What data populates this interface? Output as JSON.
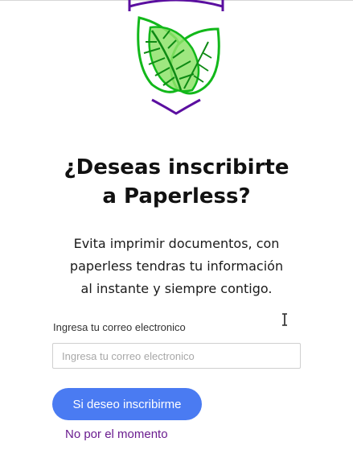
{
  "logo": {
    "icon": "leaf-shield-icon",
    "colors": {
      "shield": "#5b0fa0",
      "leaf_outline": "#12b81a",
      "leaf_fill": "#8ee36a"
    }
  },
  "heading": {
    "line1": "¿Deseas inscribirte",
    "line2": "a Paperless?"
  },
  "description": {
    "line1": "Evita imprimir documentos, con",
    "line2": "paperless tendras tu información",
    "line3": "al instante y siempre contigo."
  },
  "form": {
    "email_label": "Ingresa tu correo electronico",
    "email_placeholder": "Ingresa tu correo electronico",
    "email_value": ""
  },
  "actions": {
    "subscribe_label": "Si deseo inscribirme",
    "decline_label": "No por el momento",
    "primary_color": "#4a7bf2",
    "link_color": "#6a1c8f"
  },
  "cursor": {
    "icon": "text-cursor-icon"
  }
}
